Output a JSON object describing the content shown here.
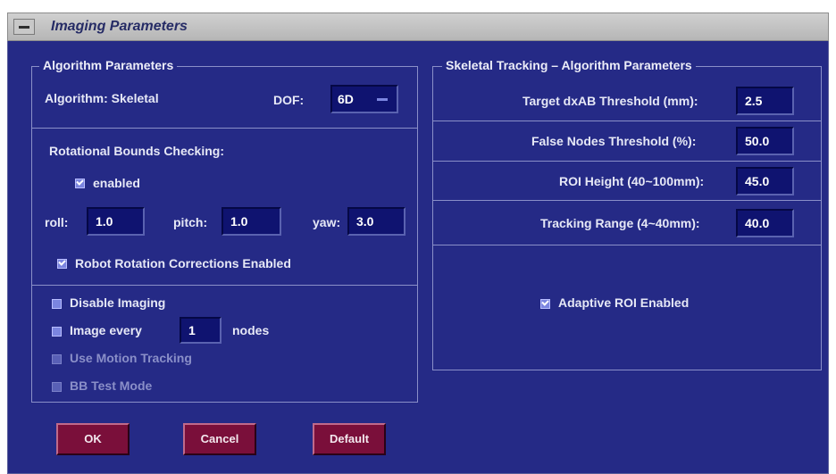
{
  "window": {
    "title": "Imaging Parameters"
  },
  "left_panel": {
    "legend": "Algorithm Parameters",
    "algorithm_label": "Algorithm: Skeletal",
    "dof_label": "DOF:",
    "dof_value": "6D",
    "rotational_heading": "Rotational Bounds Checking:",
    "enabled_label": "enabled",
    "roll_label": "roll:",
    "roll_value": "1.0",
    "pitch_label": "pitch:",
    "pitch_value": "1.0",
    "yaw_label": "yaw:",
    "yaw_value": "3.0",
    "robot_rotation_label": "Robot Rotation Corrections Enabled",
    "disable_imaging_label": "Disable Imaging",
    "image_every_label": "Image every",
    "image_every_value": "1",
    "nodes_label": "nodes",
    "motion_tracking_label": "Use Motion Tracking",
    "bb_test_label": "BB Test Mode"
  },
  "right_panel": {
    "legend": "Skeletal Tracking – Algorithm Parameters",
    "target_label": "Target dxAB Threshold (mm):",
    "target_value": "2.5",
    "false_nodes_label": "False Nodes Threshold (%):",
    "false_nodes_value": "50.0",
    "roi_height_label": "ROI Height (40~100mm):",
    "roi_height_value": "45.0",
    "tracking_range_label": "Tracking Range (4~40mm):",
    "tracking_range_value": "40.0",
    "adaptive_roi_label": "Adaptive ROI Enabled"
  },
  "buttons": {
    "ok": "OK",
    "cancel": "Cancel",
    "default": "Default"
  },
  "colors": {
    "background": "#252a86",
    "field": "#0f1370",
    "button": "#7a0f3a",
    "text": "#e6e8f6"
  }
}
